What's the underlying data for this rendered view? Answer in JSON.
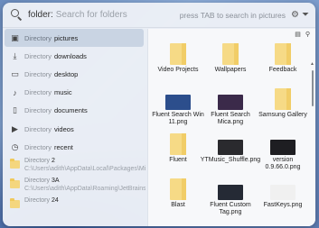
{
  "search": {
    "query": "folder:",
    "placeholder": "Search for folders",
    "hint": "press TAB to search in pictures",
    "icon": "search-icon"
  },
  "list": {
    "kind_label": "Directory",
    "items": [
      {
        "name": "pictures",
        "icon": "pictures-icon",
        "selected": true
      },
      {
        "name": "downloads",
        "icon": "download-icon"
      },
      {
        "name": "desktop",
        "icon": "desktop-icon"
      },
      {
        "name": "music",
        "icon": "music-icon"
      },
      {
        "name": "documents",
        "icon": "document-icon"
      },
      {
        "name": "videos",
        "icon": "video-icon"
      },
      {
        "name": "recent",
        "icon": "recent-icon"
      }
    ],
    "path_items": [
      {
        "name": "2",
        "path": "C:\\Users\\adith\\AppData\\Local\\Packages\\Mic"
      },
      {
        "name": "3A",
        "path": "C:\\Users\\adith\\AppData\\Roaming\\JetBrains\\"
      },
      {
        "name": "24",
        "path": ""
      }
    ]
  },
  "grid": {
    "tiles": [
      {
        "label": "Video Projects",
        "type": "folder"
      },
      {
        "label": "Wallpapers",
        "type": "folder"
      },
      {
        "label": "Feedback",
        "type": "folder"
      },
      {
        "label": "Fluent Search Win 11.png",
        "type": "image",
        "color": "#2c4e8c"
      },
      {
        "label": "Fluent Search Mica.png",
        "type": "image",
        "color": "#3b2a4a"
      },
      {
        "label": "Samsung Gallery",
        "type": "folder"
      },
      {
        "label": "Fluent",
        "type": "folder"
      },
      {
        "label": "YTMusic_Shuffle.png",
        "type": "image",
        "color": "#2a2a2e"
      },
      {
        "label": "version 0.9.66.0.png",
        "type": "image",
        "color": "#1e1e22"
      },
      {
        "label": "Blast",
        "type": "folder"
      },
      {
        "label": "Fluent Custom Tag.png",
        "type": "image",
        "color": "#252a35"
      },
      {
        "label": "FastKeys.png",
        "type": "image",
        "color": "#f0f0f0"
      }
    ]
  },
  "colors": {
    "folder": "#f6da86",
    "selected_bg": "#c9d4e3"
  }
}
